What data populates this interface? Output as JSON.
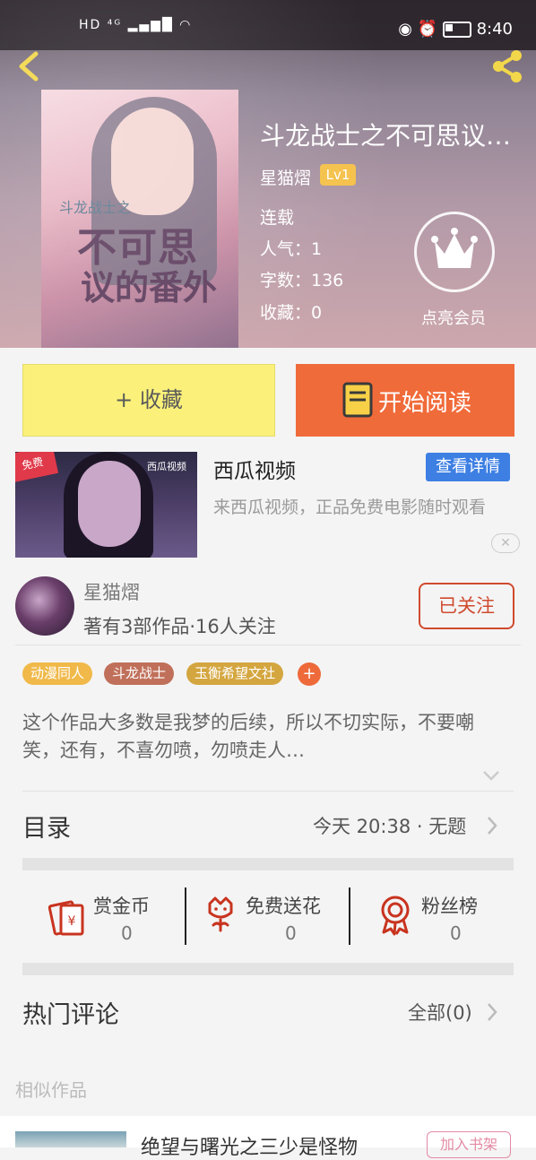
{
  "status_bar": {
    "left": "HD ⁴ᴳ ▂▄▆█ ◠",
    "time": "8:40"
  },
  "book": {
    "title": "斗龙战士之不可思议…",
    "cover_text_small": "斗龙战士之",
    "cover_text_line1": "不可思",
    "cover_text_line2": "议的番外",
    "author": "星猫熠",
    "level": "Lv1",
    "status": "连载",
    "popularity": "人气：1",
    "word_count": "字数：136",
    "favorites": "收藏：0",
    "vip_label": "点亮会员"
  },
  "actions": {
    "collect": "+ 收藏",
    "read": "开始阅读"
  },
  "ad": {
    "badge": "免费",
    "logo": "西瓜视频",
    "title": "西瓜视频",
    "detail": "查看详情",
    "desc": "来西瓜视频，正品免费电影随时观看",
    "close": "✕"
  },
  "author_card": {
    "name": "星猫熠",
    "stats": "著有3部作品·16人关注",
    "follow": "已关注"
  },
  "tags": [
    {
      "label": "动漫同人",
      "color": "#f0b94a"
    },
    {
      "label": "斗龙战士",
      "color": "#c0705a"
    },
    {
      "label": "玉衡希望文社",
      "color": "#d4a63f"
    }
  ],
  "tag_add": "+",
  "synopsis": "这个作品大多数是我梦的后续，所以不切实际，不要嘲笑，还有，不喜勿喷，勿喷走人…",
  "toc": {
    "label": "目录",
    "latest": "今天 20:38 · 无题"
  },
  "stats": [
    {
      "label": "赏金币",
      "value": "0",
      "icon": "coin-envelope-icon"
    },
    {
      "label": "免费送花",
      "value": "0",
      "icon": "flower-icon"
    },
    {
      "label": "粉丝榜",
      "value": "0",
      "icon": "medal-icon"
    }
  ],
  "comments": {
    "label": "热门评论",
    "all": "全部(0)"
  },
  "similar": {
    "label": "相似作品",
    "first_title": "绝望与曙光之三少是怪物",
    "add_shelf": "加入书架"
  },
  "colors": {
    "accent_orange": "#f06b3a",
    "accent_yellow": "#fbf17a",
    "follow_red": "#d04a2f",
    "icon_red": "#c8341f"
  }
}
